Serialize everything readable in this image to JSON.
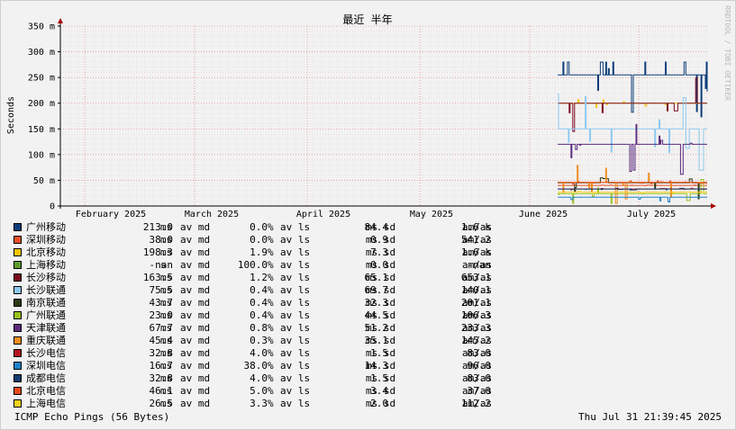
{
  "chart_data": {
    "type": "line",
    "title": "最近 半年",
    "ylabel": "Seconds",
    "xlabel": "",
    "y_ticks": [
      "0",
      "50 m",
      "100 m",
      "150 m",
      "200 m",
      "250 m",
      "300 m",
      "350 m"
    ],
    "ylim": [
      0,
      0.35
    ],
    "x_ticks": [
      "February 2025",
      "March 2025",
      "April 2025",
      "May 2025",
      "June 2025",
      "July 2025"
    ],
    "grid": true,
    "signature": "RRDTOOL / TOBI OETIKER",
    "legend_columns": [
      "av md",
      "av ls",
      "ms sd",
      "am/as"
    ],
    "series": [
      {
        "name": "广州移动",
        "color": "#0b3c78",
        "median": "213.0",
        "median_unit": "ms",
        "loss": "0.0",
        "sd": "84.4",
        "sd_unit": "ms",
        "amas": "1.6 k",
        "level": 0.255
      },
      {
        "name": "深圳移动",
        "color": "#e8502a",
        "median": "38.0",
        "median_unit": "ms",
        "loss": "0.0",
        "sd": "0.9",
        "sd_unit": "ms",
        "amas": "541.2",
        "level": 0.04
      },
      {
        "name": "北京移动",
        "color": "#f5c400",
        "median": "198.3",
        "median_unit": "ms",
        "loss": "1.9",
        "sd": "7.3",
        "sd_unit": "ms",
        "amas": "1.6 k",
        "level": 0.2
      },
      {
        "name": "上海移动",
        "color": "#5f9d2f",
        "median": "-nan",
        "median_unit": "s",
        "loss": "100.0",
        "sd": "0.0",
        "sd_unit": "ms",
        "amas": "-nan",
        "level": null
      },
      {
        "name": "长沙移动",
        "color": "#7a0a1e",
        "median": "163.5",
        "median_unit": "ms",
        "loss": "1.2",
        "sd": "65.1",
        "sd_unit": "ms",
        "amas": "653.1",
        "level": 0.2
      },
      {
        "name": "长沙联通",
        "color": "#8cc8f0",
        "median": "75.5",
        "median_unit": "ms",
        "loss": "0.4",
        "sd": "69.7",
        "sd_unit": "ms",
        "amas": "140.1",
        "level": 0.15
      },
      {
        "name": "南京联通",
        "color": "#2b3a14",
        "median": "43.7",
        "median_unit": "ms",
        "loss": "0.4",
        "sd": "32.3",
        "sd_unit": "ms",
        "amas": "201.1",
        "level": 0.045
      },
      {
        "name": "广州联通",
        "color": "#9ac31c",
        "median": "23.0",
        "median_unit": "ms",
        "loss": "0.4",
        "sd": "44.5",
        "sd_unit": "ms",
        "amas": "106.3",
        "level": 0.024
      },
      {
        "name": "天津联通",
        "color": "#5b2a7e",
        "median": "67.7",
        "median_unit": "ms",
        "loss": "0.8",
        "sd": "51.2",
        "sd_unit": "ms",
        "amas": "233.3",
        "level": 0.12
      },
      {
        "name": "重庆联通",
        "color": "#f08c1e",
        "median": "45.4",
        "median_unit": "ms",
        "loss": "0.3",
        "sd": "35.1",
        "sd_unit": "ms",
        "amas": "145.2",
        "level": 0.046
      },
      {
        "name": "长沙电信",
        "color": "#b4141e",
        "median": "32.8",
        "median_unit": "ms",
        "loss": "4.0",
        "sd": "1.5",
        "sd_unit": "ms",
        "amas": "83.0",
        "level": 0.033
      },
      {
        "name": "深圳电信",
        "color": "#1e82c8",
        "median": "16.7",
        "median_unit": "ms",
        "loss": "38.0",
        "sd": "14.3",
        "sd_unit": "ms",
        "amas": "96.0",
        "level": 0.017
      },
      {
        "name": "成都电信",
        "color": "#143c6e",
        "median": "32.8",
        "median_unit": "ms",
        "loss": "4.0",
        "sd": "1.5",
        "sd_unit": "ms",
        "amas": "83.0",
        "level": 0.033
      },
      {
        "name": "北京电信",
        "color": "#e84a1e",
        "median": "46.1",
        "median_unit": "ms",
        "loss": "5.0",
        "sd": "3.4",
        "sd_unit": "ms",
        "amas": "37.0",
        "level": 0.046
      },
      {
        "name": "上海电信",
        "color": "#f8d21e",
        "median": "26.5",
        "median_unit": "ms",
        "loss": "3.3",
        "sd": "2.0",
        "sd_unit": "ms",
        "amas": "112.2",
        "level": 0.027
      }
    ]
  },
  "footer": {
    "left": "ICMP Echo Pings (56 Bytes)",
    "right": "Thu Jul 31 21:39:45 2025"
  }
}
